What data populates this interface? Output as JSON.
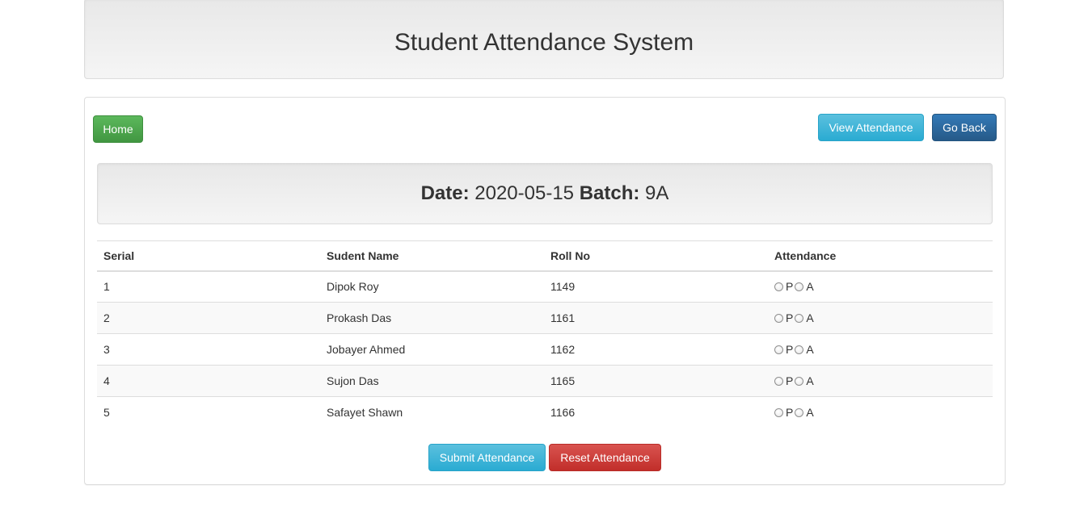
{
  "header": {
    "title": "Student Attendance System"
  },
  "nav": {
    "home_label": "Home",
    "view_attendance_label": "View Attendance",
    "go_back_label": "Go Back"
  },
  "info": {
    "date_label": "Date:",
    "date_value": "2020-05-15",
    "batch_label": "Batch:",
    "batch_value": "9A"
  },
  "table": {
    "columns": [
      "Serial",
      "Sudent Name",
      "Roll No",
      "Attendance"
    ],
    "rows": [
      {
        "serial": "1",
        "name": "Dipok Roy",
        "roll": "1149"
      },
      {
        "serial": "2",
        "name": "Prokash Das",
        "roll": "1161"
      },
      {
        "serial": "3",
        "name": "Jobayer Ahmed",
        "roll": "1162"
      },
      {
        "serial": "4",
        "name": "Sujon Das",
        "roll": "1165"
      },
      {
        "serial": "5",
        "name": "Safayet Shawn",
        "roll": "1166"
      }
    ],
    "present_label": "P",
    "absent_label": "A"
  },
  "actions": {
    "submit_label": "Submit Attendance",
    "reset_label": "Reset Attendance"
  },
  "colors": {
    "success": "#5cb85c",
    "info": "#5bc0de",
    "primary": "#337ab7",
    "danger": "#d9534f"
  }
}
